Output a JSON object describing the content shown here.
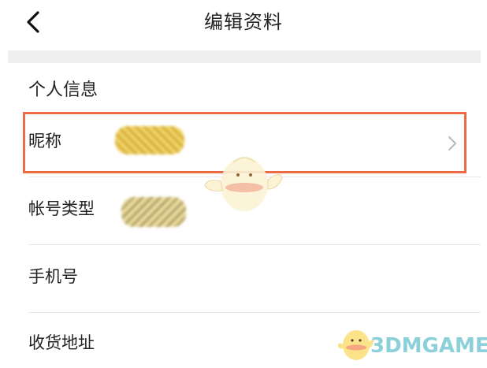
{
  "header": {
    "title": "编辑资料",
    "back_icon": "chevron-left-icon"
  },
  "section": {
    "title": "个人信息"
  },
  "rows": [
    {
      "label": "昵称",
      "value_obscured": true,
      "has_chevron": true,
      "highlighted": true
    },
    {
      "label": "帐号类型",
      "value_obscured": true,
      "has_chevron": false,
      "highlighted": false
    },
    {
      "label": "手机号",
      "value_obscured": false,
      "has_chevron": false,
      "highlighted": false
    },
    {
      "label": "收货地址",
      "value_obscured": false,
      "has_chevron": false,
      "highlighted": false
    }
  ],
  "watermark": {
    "text": "3DMGAME"
  },
  "colors": {
    "highlight_border": "#ec6a45",
    "background_band": "#efefef",
    "blur_value": "#e2b832",
    "chevron": "#bbbbbb",
    "watermark": "#78c8d2"
  }
}
